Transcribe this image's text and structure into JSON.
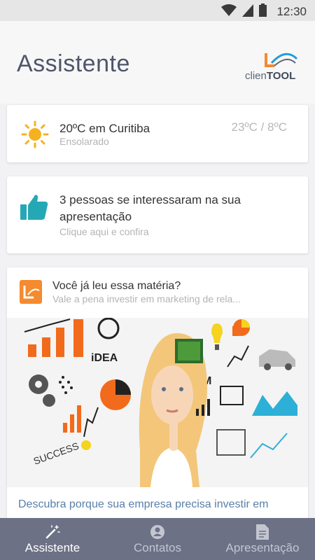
{
  "status_bar": {
    "time": "12:30",
    "icons": [
      "wifi-icon",
      "signal-icon",
      "battery-icon"
    ]
  },
  "header": {
    "title": "Assistente",
    "logo": {
      "text_light": "clien",
      "text_bold": "TOOL"
    }
  },
  "weather": {
    "title": "20ºC em Curitiba",
    "condition": "Ensolarado",
    "range": "23ºC / 8ºC",
    "icon": "sun-icon"
  },
  "interest": {
    "title": "3 pessoas se interessaram na sua apresentação",
    "subtitle": "Clique aqui e confira",
    "icon": "thumbs-up-icon"
  },
  "article": {
    "title": "Você já leu essa matéria?",
    "subtitle": "Vale a pena investir em marketing de rela...",
    "description": "Descubra porque sua empresa precisa investir em",
    "image_labels": {
      "idea": "iDEA",
      "team": "TEAM",
      "success": "SUCCESS"
    }
  },
  "bottom_nav": {
    "items": [
      {
        "label": "Assistente",
        "icon": "magic-wand-icon",
        "active": true
      },
      {
        "label": "Contatos",
        "icon": "person-icon",
        "active": false
      },
      {
        "label": "Apresentação",
        "icon": "document-icon",
        "active": false
      }
    ]
  },
  "colors": {
    "accent": "#f58a2e",
    "nav_bg": "#6d7186",
    "link": "#5a7fa8",
    "thumb": "#25a8b5",
    "sun": "#f5b21e"
  }
}
